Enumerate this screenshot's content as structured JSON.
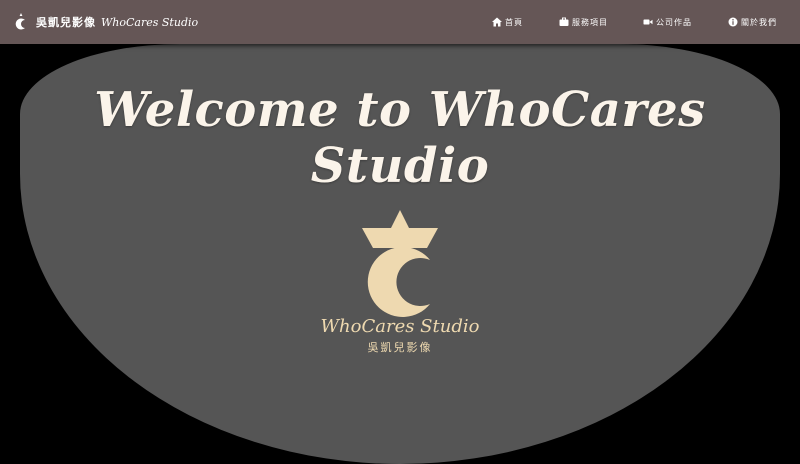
{
  "brand": {
    "logo_icon": "crescent-crown-icon",
    "name_cn": "吳凱兒影像",
    "name_en": "WhoCares Studio"
  },
  "nav": {
    "items": [
      {
        "icon": "home-icon",
        "label": "首頁"
      },
      {
        "icon": "briefcase-icon",
        "label": "服務項目"
      },
      {
        "icon": "video-icon",
        "label": "公司作品"
      },
      {
        "icon": "info-icon",
        "label": "關於我們"
      }
    ]
  },
  "hero": {
    "title": "Welcome to WhoCares Studio",
    "logo_en": "WhoCares Studio",
    "logo_cn": "吳凱兒影像"
  },
  "colors": {
    "navbar": "#655656",
    "hero_bg": "#555555",
    "page_bg": "#000000",
    "logo_gold": "#eed9b0",
    "title_text": "#fbf4ea"
  }
}
